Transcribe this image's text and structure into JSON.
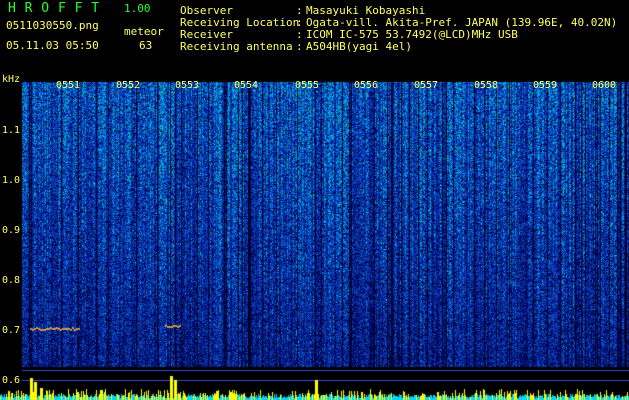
{
  "header": {
    "brand": "H R O F F T",
    "version": "1.00",
    "filename": "0511030550.png",
    "datetime": "05.11.03 05:50",
    "meteor_label": "meteor",
    "meteor_count": "63"
  },
  "info": {
    "observer_key": "Observer",
    "observer_val": "Masayuki Kobayashi",
    "location_key": "Receiving Location",
    "location_val": "Ogata-vill. Akita-Pref. JAPAN (139.96E, 40.02N)",
    "receiver_key": "Receiver",
    "receiver_val": "ICOM IC-575 53.7492(@LCD)MHz USB",
    "antenna_key": "Receiving antenna",
    "antenna_val": "A504HB(yagi 4el)",
    "colon": ":"
  },
  "axis": {
    "y_unit": "kHz",
    "y_ticks": [
      "1.1",
      "1.0",
      "0.9",
      "0.8",
      "0.7",
      "0.6"
    ],
    "x_ticks": [
      "0551",
      "0552",
      "0553",
      "0554",
      "0555",
      "0556",
      "0557",
      "0558",
      "0559",
      "0600"
    ]
  },
  "colors": {
    "text": "#ffff66",
    "brand": "#28ff28",
    "signal": "#ffff00",
    "noise_floor": "#00d8ff"
  }
}
